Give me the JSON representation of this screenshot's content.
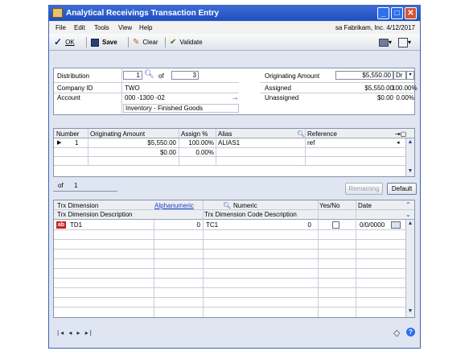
{
  "window": {
    "title": "Analytical Receivings Transaction Entry",
    "controls": {
      "minimize": "_",
      "maximize": "□",
      "close": "✕"
    }
  },
  "menu": {
    "items": [
      "File",
      "Edit",
      "Tools",
      "View",
      "Help"
    ],
    "user_info": "sa  Fabrikam, Inc.  4/12/2017"
  },
  "toolbar": {
    "ok": "OK",
    "save": "Save",
    "clear": "Clear",
    "validate": "Validate"
  },
  "header": {
    "distribution_label": "Distribution",
    "distribution_value": "1",
    "of_label": "of",
    "of_value": "3",
    "company_label": "Company ID",
    "company_value": "TWO",
    "account_label": "Account",
    "account_value": "000 -1300 -02",
    "account_description": "Inventory - Finished Goods",
    "originating_amount_label": "Originating Amount",
    "originating_amount_value": "$5,550.00",
    "dr_cr": "Dr",
    "assigned_label": "Assigned",
    "assigned_value": "$5,550.00",
    "assigned_pct": "100.00%",
    "unassigned_label": "Unassigned",
    "unassigned_value": "$0.00",
    "unassigned_pct": "0.00%"
  },
  "assign_grid": {
    "columns": [
      "Number",
      "Originating Amount",
      "Assign %",
      "Alias",
      "Reference"
    ],
    "rows": [
      {
        "number": "1",
        "amount": "$5,550.00",
        "pct": "100.00%",
        "alias": "ALIAS1",
        "reference": "ref"
      },
      {
        "number": "",
        "amount": "$0.00",
        "pct": "0.00%",
        "alias": "",
        "reference": ""
      }
    ],
    "of_label": "of",
    "of_value": "1",
    "remaining_button": "Remaining",
    "default_button": "Default"
  },
  "dimension_grid": {
    "columns_row1": [
      "Trx Dimension",
      "Alphanumeric",
      "Numeric",
      "Yes/No",
      "Date"
    ],
    "columns_row2": [
      "Trx Dimension Description",
      "Trx Dimension Code Description"
    ],
    "rows": [
      {
        "type_icon": "ab",
        "dimension": "TD1",
        "alpha_num": "0",
        "code": "TC1",
        "numeric": "0",
        "date": "0/0/0000"
      }
    ]
  },
  "footer": {
    "nav": "|◂ ◂ ▸ ▸|"
  }
}
